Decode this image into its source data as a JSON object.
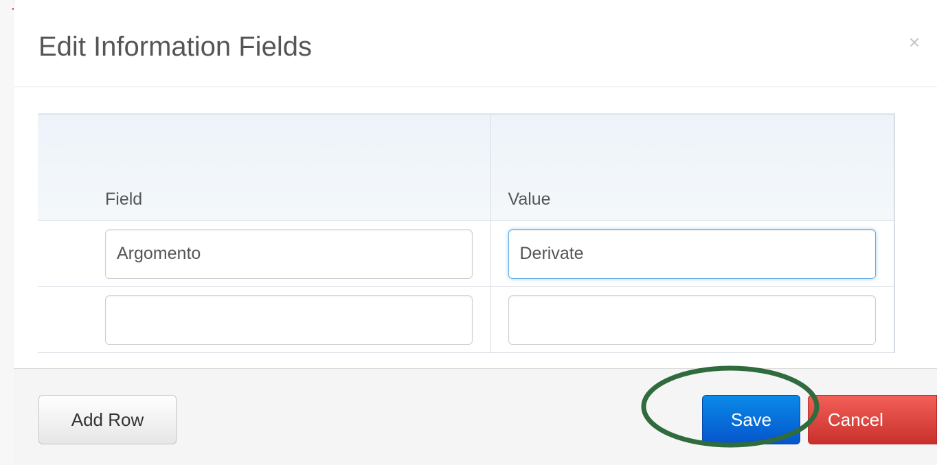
{
  "dialog": {
    "title": "Edit Information Fields",
    "close_label": "×"
  },
  "table": {
    "headers": {
      "field": "Field",
      "value": "Value"
    },
    "rows": [
      {
        "field": "Argomento",
        "value": "Derivate"
      },
      {
        "field": "",
        "value": ""
      }
    ]
  },
  "footer": {
    "add_row_label": "Add Row",
    "save_label": "Save",
    "cancel_label": "Cancel"
  },
  "colors": {
    "save_button": "#0a6fdc",
    "cancel_button": "#d9534f",
    "highlight_ellipse": "#2f6b3c",
    "focus_ring": "#66afe9"
  },
  "annotation": {
    "shape": "ellipse",
    "target": "save-button"
  }
}
